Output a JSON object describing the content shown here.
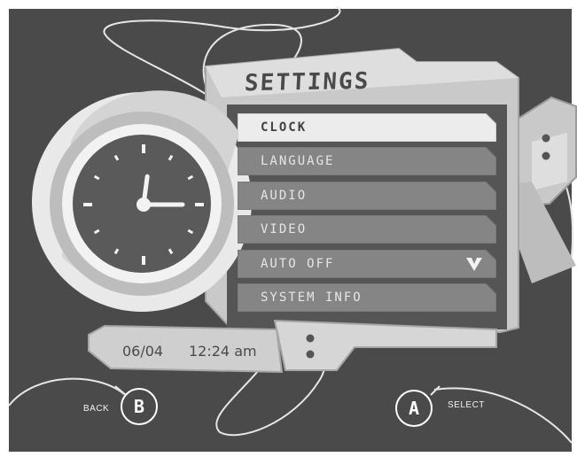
{
  "screen": {
    "title": "SETTINGS"
  },
  "menu": {
    "items": [
      {
        "label": "CLOCK",
        "selected": true
      },
      {
        "label": "LANGUAGE",
        "selected": false
      },
      {
        "label": "AUDIO",
        "selected": false
      },
      {
        "label": "VIDEO",
        "selected": false
      },
      {
        "label": "AUTO OFF",
        "selected": false,
        "has_chevron": true
      },
      {
        "label": "SYSTEM INFO",
        "selected": false
      }
    ],
    "scroll_icon": "chevron-down-icon"
  },
  "status": {
    "date": "06/04",
    "time": "12:24 am"
  },
  "clock": {
    "hour": 12,
    "minute": 15
  },
  "controls": {
    "back": {
      "button": "B",
      "label": "BACK"
    },
    "select": {
      "button": "A",
      "label": "SELECT"
    }
  },
  "colors": {
    "background": "#4a4a4a",
    "panel": "#c8c8c8",
    "item": "#858585",
    "item_selected": "#ececec"
  }
}
